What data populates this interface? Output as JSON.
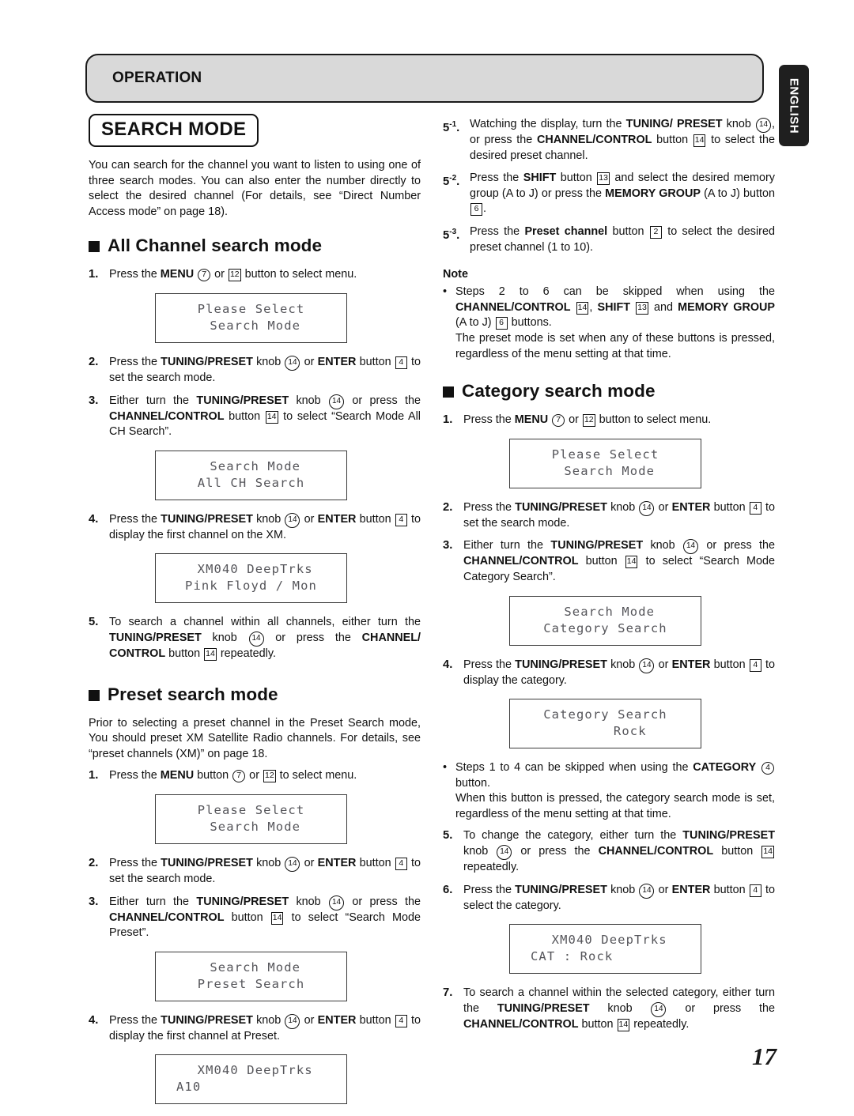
{
  "header": {
    "section_label": "OPERATION",
    "language_tab": "ENGLISH",
    "page_number": "17"
  },
  "left_column": {
    "title": "SEARCH MODE",
    "intro": "You can search for the channel you want to listen to using one of three search modes. You can also enter the number directly to select the desired channel (For details, see “Direct Number Access mode” on page 18).",
    "all_channel": {
      "heading": "All Channel search mode",
      "steps": [
        {
          "num": "1.",
          "text_html": "Press the <b>MENU</b> <span class=\"ref-c\">7</span> or <span class=\"ref-b\">12</span> button to select menu."
        },
        {
          "num": "2.",
          "text_html": "Press the <b>TUNING/PRESET</b> knob <span class=\"ref-c wide\">14</span> or <b>ENTER</b> button <span class=\"ref-b\">4</span> to set the search mode."
        },
        {
          "num": "3.",
          "text_html": "Either turn the <b>TUNING/PRESET</b> knob <span class=\"ref-c wide\">14</span> or press the <b>CHANNEL/CONTROL</b> button <span class=\"ref-b\">14</span> to select “Search Mode All CH Search”."
        },
        {
          "num": "4.",
          "text_html": "Press the <b>TUNING/PRESET</b> knob <span class=\"ref-c wide\">14</span> or <b>ENTER</b> button <span class=\"ref-b\">4</span> to display the first channel on the XM."
        },
        {
          "num": "5.",
          "text_html": "To search a channel within all channels, either turn the <b>TUNING/PRESET</b> knob <span class=\"ref-c wide\">14</span> or press the <b>CHANNEL/ CONTROL</b> button <span class=\"ref-b\">14</span> repeatedly."
        }
      ],
      "lcd_1": {
        "line1": "Please Select",
        "line2": " Search Mode"
      },
      "lcd_2": {
        "line1": " Search Mode",
        "line2": "All CH Search"
      },
      "lcd_3": {
        "line1": " XM040 DeepTrks",
        "line2": "Pink Floyd / Mon"
      }
    },
    "preset": {
      "heading": "Preset search mode",
      "intro": "Prior to selecting a preset channel in the Preset Search mode, You should preset XM Satellite Radio channels. For details, see “preset channels (XM)” on page 18.",
      "steps": [
        {
          "num": "1.",
          "text_html": "Press the <b>MENU</b> button <span class=\"ref-c\">7</span> or <span class=\"ref-b\">12</span> to select menu."
        },
        {
          "num": "2.",
          "text_html": "Press the <b>TUNING/PRESET</b> knob <span class=\"ref-c wide\">14</span> or <b>ENTER</b> button <span class=\"ref-b\">4</span> to set the search mode."
        },
        {
          "num": "3.",
          "text_html": "Either turn the <b>TUNING/PRESET</b> knob <span class=\"ref-c wide\">14</span> or press the <b>CHANNEL/CONTROL</b> button <span class=\"ref-b\">14</span> to select “Search Mode Preset”."
        },
        {
          "num": "4.",
          "text_html": "Press the <b>TUNING/PRESET</b> knob <span class=\"ref-c wide\">14</span> or <b>ENTER</b> button <span class=\"ref-b\">4</span> to display the first channel at Preset."
        }
      ],
      "lcd_1": {
        "line1": "Please Select",
        "line2": " Search Mode"
      },
      "lcd_2": {
        "line1": " Search Mode",
        "line2": "Preset Search"
      },
      "lcd_3": {
        "line1": " XM040 DeepTrks",
        "line2": "A10"
      }
    }
  },
  "right_column": {
    "sub_steps": [
      {
        "num": "5",
        "sup": "-1",
        "text_html": "Watching the display, turn the <b>TUNING/ PRESET</b> knob <span class=\"ref-c wide\">14</span>, or press the <b>CHANNEL/CONTROL</b> button <span class=\"ref-b\">14</span> to select the desired preset channel."
      },
      {
        "num": "5",
        "sup": "-2",
        "text_html": "Press the <b>SHIFT</b> button <span class=\"ref-b\">13</span> and select the desired memory group (A to J) or press the <b>MEMORY GROUP</b> (A to J) button <span class=\"ref-b\">6</span>."
      },
      {
        "num": "5",
        "sup": "-3",
        "text_html": "Press the <b>Preset channel</b> button <span class=\"ref-b\">2</span> to select the desired preset channel (1 to 10)."
      }
    ],
    "note_heading": "Note",
    "note_bullet_html": "Steps 2 to 6 can be skipped when using the <b>CHANNEL/CONTROL</b> <span class=\"ref-b\">14</span>, <b>SHIFT</b> <span class=\"ref-b\">13</span> and <b>MEMORY GROUP</b> (A to J) <span class=\"ref-b\">6</span> buttons.<br>The preset mode is set when any of these buttons is pressed, regardless of the menu setting at that time.",
    "category": {
      "heading": "Category search mode",
      "steps": [
        {
          "num": "1.",
          "text_html": "Press the <b>MENU</b> <span class=\"ref-c\">7</span> or <span class=\"ref-b\">12</span> button to select menu."
        },
        {
          "num": "2.",
          "text_html": "Press the <b>TUNING/PRESET</b> knob <span class=\"ref-c wide\">14</span> or <b>ENTER</b> button <span class=\"ref-b\">4</span> to set the search mode."
        },
        {
          "num": "3.",
          "text_html": "Either turn the <b>TUNING/PRESET</b> knob <span class=\"ref-c wide\">14</span> or press the <b>CHANNEL/CONTROL</b> button <span class=\"ref-b\">14</span> to select “Search Mode Category Search”."
        },
        {
          "num": "4.",
          "text_html": "Press the <b>TUNING/PRESET</b> knob <span class=\"ref-c wide\">14</span> or <b>ENTER</b> button <span class=\"ref-b\">4</span> to display the category."
        },
        {
          "num": "5.",
          "text_html": "To change the category, either turn the <b>TUNING/PRESET</b> knob <span class=\"ref-c wide\">14</span> or press the <b>CHANNEL/CONTROL</b> button <span class=\"ref-b\">14</span> repeatedly."
        },
        {
          "num": "6.",
          "text_html": "Press the <b>TUNING/PRESET</b> knob <span class=\"ref-c wide\">14</span> or <b>ENTER</b> button <span class=\"ref-b\">4</span> to select the category."
        },
        {
          "num": "7.",
          "text_html": "To search a channel within the selected category, either turn the <b>TUNING/PRESET</b> knob <span class=\"ref-c wide\">14</span> or press the <b>CHANNEL/CONTROL</b> button <span class=\"ref-b\">14</span> repeatedly."
        }
      ],
      "bullet_html": "Steps 1 to 4 can be skipped when using the <b>CATEGORY</b> <span class=\"ref-c\">4</span> button.<br>When this button is pressed, the category search mode is set, regardless of the menu setting at that time.",
      "lcd_1": {
        "line1": "Please Select",
        "line2": " Search Mode"
      },
      "lcd_2": {
        "line1": " Search Mode",
        "line2": "Category Search"
      },
      "lcd_3": {
        "line1": "Category Search",
        "line2": "      Rock"
      },
      "lcd_4": {
        "line1": " XM040 DeepTrks",
        "line2": "CAT : Rock"
      }
    }
  }
}
